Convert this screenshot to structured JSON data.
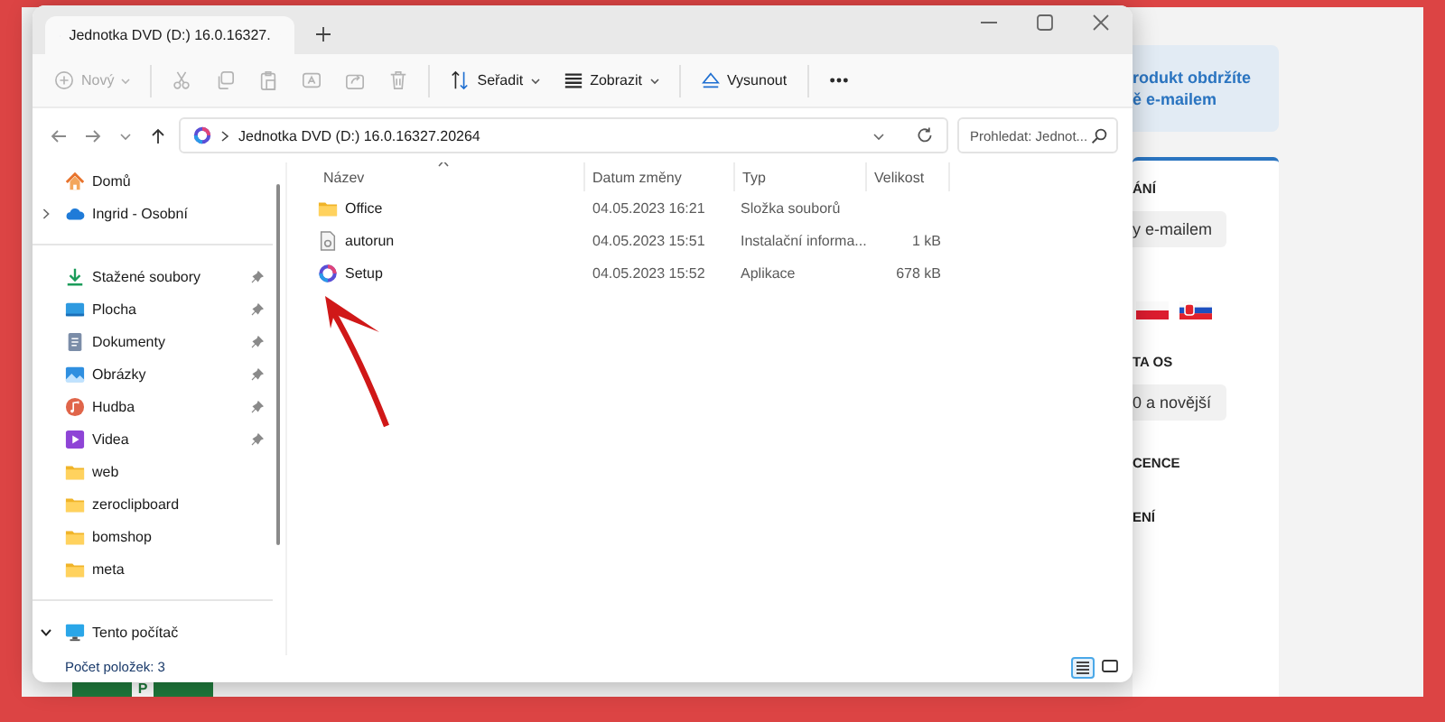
{
  "tab": {
    "title": "Jednotka DVD (D:) 16.0.16327."
  },
  "toolbar": [
    [
      {
        "kind": "new",
        "label": "Nový",
        "dropdown": true,
        "disabled": true
      }
    ],
    [
      {
        "kind": "cut",
        "disabled": true
      },
      {
        "kind": "copy",
        "disabled": true
      },
      {
        "kind": "paste",
        "disabled": true
      },
      {
        "kind": "rename",
        "disabled": true
      },
      {
        "kind": "share",
        "disabled": true
      },
      {
        "kind": "delete",
        "disabled": true
      }
    ],
    [
      {
        "kind": "sort",
        "label": "Seřadit",
        "dropdown": true,
        "disabled": false
      },
      {
        "kind": "view",
        "label": "Zobrazit",
        "dropdown": true,
        "disabled": false
      }
    ],
    [
      {
        "kind": "eject",
        "label": "Vysunout",
        "disabled": false
      }
    ],
    [
      {
        "kind": "more",
        "disabled": false
      }
    ]
  ],
  "address": {
    "path": "Jednotka DVD (D:) 16.0.16327.20264"
  },
  "search": {
    "placeholder": "Prohledat: Jednot..."
  },
  "sidebar": [
    [
      {
        "label": "Domů",
        "kind": "home"
      },
      {
        "label": "Ingrid - Osobní",
        "kind": "cloud",
        "expanded": false
      }
    ],
    [
      {
        "label": "Stažené soubory",
        "kind": "download",
        "pinned": true
      },
      {
        "label": "Plocha",
        "kind": "desktop",
        "pinned": true
      },
      {
        "label": "Dokumenty",
        "kind": "documents",
        "pinned": true
      },
      {
        "label": "Obrázky",
        "kind": "pictures",
        "pinned": true
      },
      {
        "label": "Hudba",
        "kind": "music",
        "pinned": true
      },
      {
        "label": "Videa",
        "kind": "videos",
        "pinned": true
      },
      {
        "label": "web",
        "kind": "folder",
        "pinned": false
      },
      {
        "label": "zeroclipboard",
        "kind": "folder",
        "pinned": false
      },
      {
        "label": "bomshop",
        "kind": "folder",
        "pinned": false
      },
      {
        "label": "meta",
        "kind": "folder",
        "pinned": false
      }
    ],
    [
      {
        "label": "Tento počítač",
        "kind": "pc",
        "expanded": true
      }
    ]
  ],
  "columns": [
    {
      "label": "Název",
      "sorted": true
    },
    {
      "label": "Datum změny",
      "sorted": false
    },
    {
      "label": "Typ",
      "sorted": false
    },
    {
      "label": "Velikost",
      "sorted": false
    }
  ],
  "rows": [
    {
      "kind": "folder",
      "name": "Office",
      "date": "04.05.2023 16:21",
      "type": "Složka souborů"
    },
    {
      "kind": "file",
      "name": "autorun",
      "date": "04.05.2023 15:51",
      "type": "Instalační informa...",
      "size": "1 kB"
    },
    {
      "kind": "app",
      "name": "Setup",
      "date": "04.05.2023 15:52",
      "type": "Aplikace",
      "size": "678 kB"
    }
  ],
  "status": "Počet položek: 3",
  "views": [
    {
      "kind": "details",
      "selected": true
    },
    {
      "kind": "tiles",
      "selected": false
    }
  ],
  "background_page": {
    "notice": [
      "rodukt obdržíte",
      "ě e-mailem"
    ],
    "sections": [
      {
        "kind": "heading",
        "text": "ÁNÍ"
      },
      {
        "kind": "chip",
        "text": "y e-mailem"
      },
      {
        "kind": "flags",
        "flags": [
          {
            "kind": "poland"
          },
          {
            "kind": "slovakia"
          }
        ]
      },
      {
        "kind": "heading",
        "text": "TA OS"
      },
      {
        "kind": "chip",
        "text": "0 a novější"
      },
      {
        "kind": "heading",
        "text": "CENCE"
      },
      {
        "kind": "heading",
        "text": "ENÍ"
      }
    ],
    "logo_letter": "P"
  }
}
